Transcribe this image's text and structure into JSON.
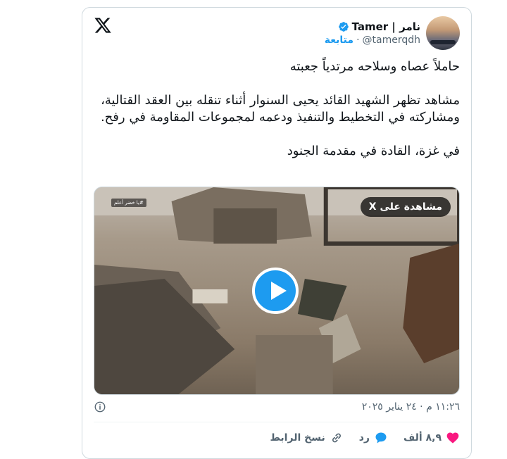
{
  "author": {
    "display_name": "نامر | Tamer",
    "handle": "@tamerqdh",
    "follow_label": "متابعة",
    "separator": "·"
  },
  "tweet": {
    "text": "حاملاً عصاه وسلاحه مرتدياً جعبته\n\nمشاهد تظهر الشهيد القائد يحيى السنوار أثناء تنقله بين العقد القتالية، ومشاركته في التخطيط والتنفيذ ودعمه لمجموعات المقاومة في رفح.\n\nفي غزة، القادة في مقدمة الجنود",
    "timestamp": "١١:٢٦ م · ٢٤ يناير ٢٠٢٥"
  },
  "media": {
    "watch_label": "مشاهدة على X",
    "channel_tag": "#يا خضر أعلم"
  },
  "actions": {
    "likes": "٨,٩ ألف",
    "reply_label": "رد",
    "copy_link_label": "نسخ الرابط"
  },
  "colors": {
    "accent": "#1d9bf0",
    "like": "#f91880",
    "text": "#0f1419",
    "muted": "#536471"
  },
  "icons": [
    "x-logo-icon",
    "verified-badge-icon",
    "play-icon",
    "info-icon",
    "heart-icon",
    "reply-bubble-icon",
    "link-icon"
  ]
}
